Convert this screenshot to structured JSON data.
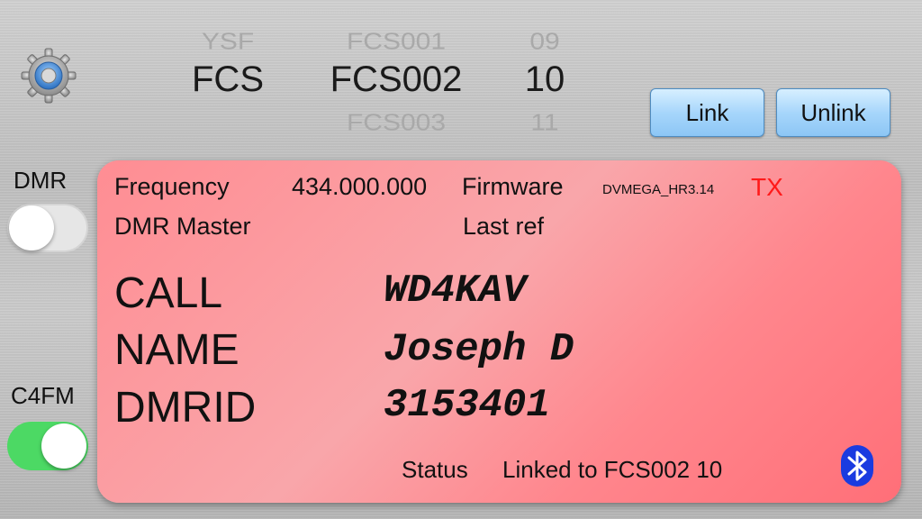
{
  "settings": {
    "icon": "gear-icon"
  },
  "picker": {
    "mode": {
      "above": "YSF",
      "selected": "FCS",
      "below": ""
    },
    "reflector": {
      "above": "FCS001",
      "selected": "FCS002",
      "below": "FCS003"
    },
    "module": {
      "above": "09",
      "selected": "10",
      "below": "11"
    }
  },
  "buttons": {
    "link": "Link",
    "unlink": "Unlink"
  },
  "toggles": {
    "dmr": {
      "label": "DMR",
      "on": false
    },
    "c4fm": {
      "label": "C4FM",
      "on": true,
      "on_color": "#4cd964"
    }
  },
  "panel": {
    "frequency_label": "Frequency",
    "frequency_value": "434.000.000",
    "firmware_label": "Firmware",
    "firmware_value": "DVMEGA_HR3.14",
    "tx": "TX",
    "tx_color": "#ff1a1a",
    "dmr_master_label": "DMR Master",
    "last_ref_label": "Last ref",
    "call_label": "CALL",
    "call_value": "WD4KAV",
    "name_label": "NAME",
    "name_value": "Joseph D",
    "dmrid_label": "DMRID",
    "dmrid_value": "3153401",
    "status_label": "Status",
    "status_value": "Linked to FCS002 10",
    "bluetooth_icon": "bluetooth-icon",
    "background_color": "#ff8d93"
  }
}
